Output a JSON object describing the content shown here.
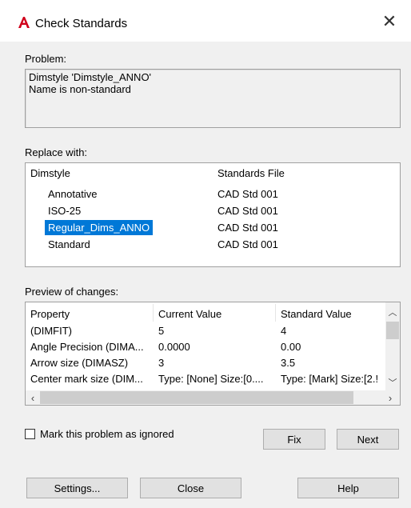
{
  "window": {
    "title": "Check Standards"
  },
  "problem": {
    "label": "Problem:",
    "line1": "Dimstyle 'Dimstyle_ANNO'",
    "line2": "Name is non-standard"
  },
  "replace": {
    "label": "Replace with:",
    "headers": [
      "Dimstyle",
      "Standards File"
    ],
    "rows": [
      {
        "name": "Annotative",
        "file": "CAD Std 001"
      },
      {
        "name": "ISO-25",
        "file": "CAD Std 001"
      },
      {
        "name": "Regular_Dims_ANNO",
        "file": "CAD Std 001"
      },
      {
        "name": "Standard",
        "file": "CAD Std 001"
      }
    ],
    "selected_index": 2
  },
  "preview": {
    "label": "Preview of changes:",
    "headers": [
      "Property",
      "Current Value",
      "Standard Value"
    ],
    "rows": [
      {
        "property": "(DIMFIT)",
        "current": "5",
        "standard": "4"
      },
      {
        "property": "Angle Precision (DIMA...",
        "current": "0.0000",
        "standard": "0.00"
      },
      {
        "property": "Arrow size (DIMASZ)",
        "current": "3",
        "standard": "3.5"
      },
      {
        "property": "Center mark size (DIM...",
        "current": "Type: [None] Size:[0....",
        "standard": "Type: [Mark] Size:[2.!"
      }
    ]
  },
  "options": {
    "ignore_label": "Mark this problem as ignored",
    "ignore_checked": false
  },
  "buttons": {
    "fix": "Fix",
    "next": "Next",
    "settings": "Settings...",
    "close": "Close",
    "help": "Help"
  },
  "colors": {
    "accent": "#0078d7",
    "app_icon": "#d0021b"
  }
}
